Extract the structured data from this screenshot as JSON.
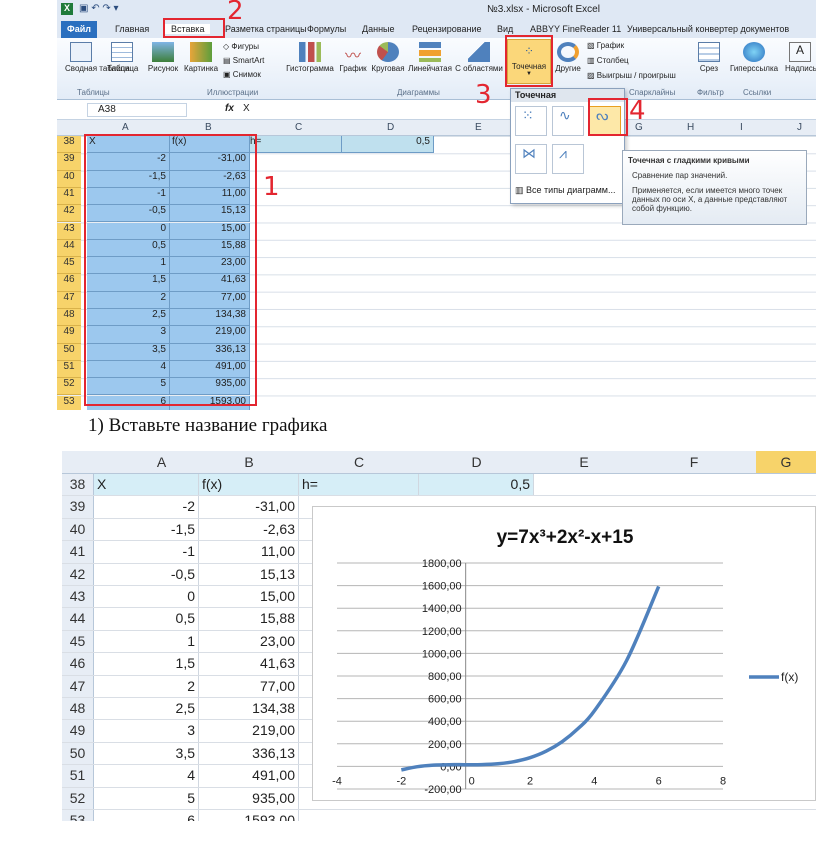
{
  "window": {
    "title": "№3.xlsx - Microsoft Excel"
  },
  "tabs": [
    "Файл",
    "Главная",
    "Вставка",
    "Разметка страницы",
    "Формулы",
    "Данные",
    "Рецензирование",
    "Вид",
    "ABBYY FineReader 11",
    "Универсальный конвертер документов"
  ],
  "ribbon": {
    "buttons": [
      "Сводная таблица",
      "Таблица",
      "Рисунок",
      "Картинка",
      "Фигуры",
      "SmartArt",
      "Снимок",
      "Гистограмма",
      "График",
      "Круговая",
      "Линейчатая",
      "С областями",
      "Точечная",
      "Другие",
      "График",
      "Столбец",
      "Выигрыш / проигрыш",
      "Срез",
      "Гиперссылка",
      "Надпись"
    ],
    "groups": [
      "Таблицы",
      "Иллюстрации",
      "Диаграммы",
      "Спарклайны",
      "Фильтр",
      "Ссылки"
    ]
  },
  "formula_bar": {
    "name_box": "A38",
    "fx": "fx",
    "value": "X"
  },
  "columns1": [
    "A",
    "B",
    "C",
    "D",
    "E",
    "F",
    "G",
    "H",
    "I",
    "J"
  ],
  "columns2": [
    "A",
    "B",
    "C",
    "D",
    "E",
    "F",
    "G"
  ],
  "header_row": {
    "num": "38",
    "a": "X",
    "b": "f(x)",
    "c": "h=",
    "d": "0,5"
  },
  "rows": [
    {
      "num": "39",
      "x": "-2",
      "fx": "-31,00"
    },
    {
      "num": "40",
      "x": "-1,5",
      "fx": "-2,63"
    },
    {
      "num": "41",
      "x": "-1",
      "fx": "11,00"
    },
    {
      "num": "42",
      "x": "-0,5",
      "fx": "15,13"
    },
    {
      "num": "43",
      "x": "0",
      "fx": "15,00"
    },
    {
      "num": "44",
      "x": "0,5",
      "fx": "15,88"
    },
    {
      "num": "45",
      "x": "1",
      "fx": "23,00"
    },
    {
      "num": "46",
      "x": "1,5",
      "fx": "41,63"
    },
    {
      "num": "47",
      "x": "2",
      "fx": "77,00"
    },
    {
      "num": "48",
      "x": "2,5",
      "fx": "134,38"
    },
    {
      "num": "49",
      "x": "3",
      "fx": "219,00"
    },
    {
      "num": "50",
      "x": "3,5",
      "fx": "336,13"
    },
    {
      "num": "51",
      "x": "4",
      "fx": "491,00"
    },
    {
      "num": "52",
      "x": "5",
      "fx": "935,00"
    },
    {
      "num": "53",
      "x": "6",
      "fx": "1593,00"
    }
  ],
  "annotations": [
    "1",
    "2",
    "3",
    "4"
  ],
  "dropdown": {
    "title": "Точечная",
    "all_types": "Все типы диаграмм..."
  },
  "tooltip": {
    "title": "Точечная с гладкими кривыми",
    "line1": "Сравнение пар значений.",
    "line2": "Применяется, если имеется много точек данных по оси X, а данные представляют собой функцию."
  },
  "instruction": "1)  Вставьте название графика",
  "colors": {
    "accent": "#2a6fbf",
    "selection": "#9cc8ee",
    "highlight": "#f7d36a",
    "annotation": "#e32630",
    "series": "#4f81bd"
  },
  "chart_data": {
    "type": "scatter",
    "title": "y=7x³+2x²-x+15",
    "x": [
      -2,
      -1.5,
      -1,
      -0.5,
      0,
      0.5,
      1,
      1.5,
      2,
      2.5,
      3,
      3.5,
      4,
      5,
      6
    ],
    "series": [
      {
        "name": "f(x)",
        "values": [
          -31,
          -2.63,
          11,
          15.13,
          15,
          15.88,
          23,
          41.63,
          77,
          134.38,
          219,
          336.13,
          491,
          935,
          1593
        ]
      }
    ],
    "xlim": [
      -4,
      8
    ],
    "ylim": [
      -200,
      1800
    ],
    "xticks": [
      "-4",
      "-2",
      "0",
      "2",
      "4",
      "6",
      "8"
    ],
    "yticks": [
      "-200,00",
      "0,00",
      "200,00",
      "400,00",
      "600,00",
      "800,00",
      "1000,00",
      "1200,00",
      "1400,00",
      "1600,00",
      "1800,00"
    ],
    "grid": true,
    "legend": "right"
  }
}
